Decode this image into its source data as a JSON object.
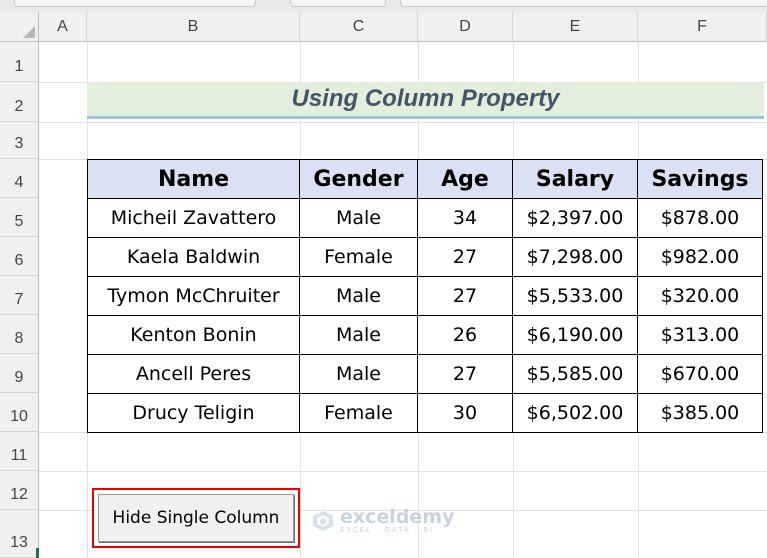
{
  "columns": [
    "A",
    "B",
    "C",
    "D",
    "E",
    "F"
  ],
  "rows": [
    "1",
    "2",
    "3",
    "4",
    "5",
    "6",
    "7",
    "8",
    "9",
    "10",
    "11",
    "12",
    "13"
  ],
  "title": "Using Column Property",
  "table": {
    "headers": [
      "Name",
      "Gender",
      "Age",
      "Salary",
      "Savings"
    ],
    "rows": [
      [
        "Micheil Zavattero",
        "Male",
        "34",
        "$2,397.00",
        "$878.00"
      ],
      [
        "Kaela Baldwin",
        "Female",
        "27",
        "$7,298.00",
        "$982.00"
      ],
      [
        "Tymon McChruiter",
        "Male",
        "27",
        "$5,533.00",
        "$320.00"
      ],
      [
        "Kenton Bonin",
        "Male",
        "26",
        "$6,190.00",
        "$313.00"
      ],
      [
        "Ancell Peres",
        "Male",
        "27",
        "$5,585.00",
        "$670.00"
      ],
      [
        "Drucy Teligin",
        "Female",
        "30",
        "$6,502.00",
        "$385.00"
      ]
    ]
  },
  "button": {
    "label": "Hide Single Column"
  },
  "watermark": {
    "name": "exceldemy",
    "tagline": "EXCEL · DATA · BI",
    "icon": "exceldemy-logo-icon"
  },
  "colors": {
    "title_fill": "#e2efda",
    "title_text": "#44546a",
    "header_fill": "#d9e1f2",
    "button_highlight": "#e60000"
  }
}
